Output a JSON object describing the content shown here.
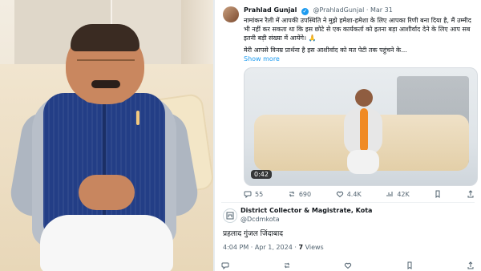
{
  "tweet": {
    "author_name": "Prahlad Gunjal",
    "author_handle": "@PrahladGunjal",
    "date": "Mar 31",
    "text_line1": "नामांकन रैली में आपकी उपस्थिति ने मुझे हमेशा-हमेशा के लिए आपका रिणी बना दिया है, मैं उम्मीद भी नहीं कर सकता था कि इस छोटे से एक कार्यकर्ता को इतना बड़ा आशीर्वाद देने के लिए आप सब इतनी बड़ी संख्या में आयेंगे। 🙏",
    "text_line2": "मेरी आपसे विनम्र प्रार्थना है इस आशीर्वाद को मत पेटी तक पहुंचने के...",
    "show_more": "Show more",
    "video_time": "0:42",
    "actions": {
      "replies": "55",
      "reposts": "690",
      "likes": "4.4K",
      "views": "42K"
    }
  },
  "quote": {
    "name": "District Collector & Magistrate, Kota",
    "handle": "@Dcdmkota",
    "body": "प्रहलाद गुंजल जिंदाबाद",
    "time": "4:04 PM",
    "date": "Apr 1, 2024",
    "views_count": "7",
    "views_label": "Views"
  },
  "colors": {
    "verified": "#1d9bf0",
    "link": "#1d9bf0",
    "muted": "#536471"
  }
}
